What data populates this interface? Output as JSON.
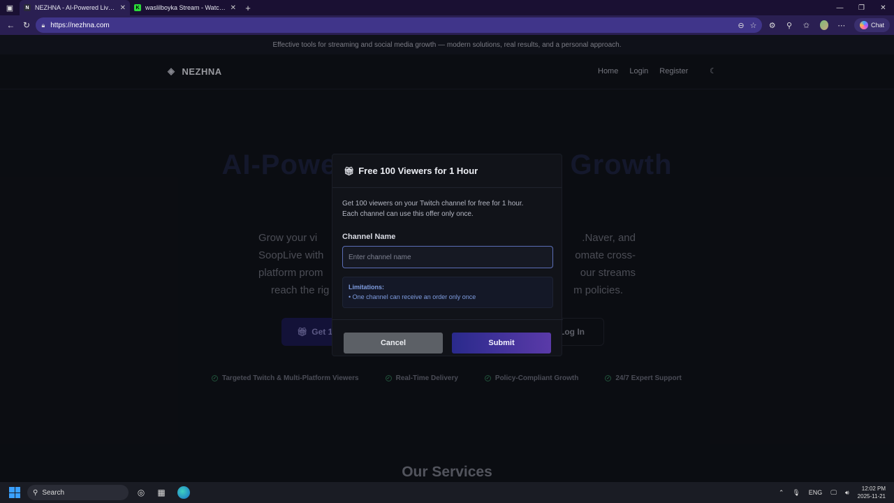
{
  "browser": {
    "tabs": [
      {
        "title": "NEZHNA - AI-Powered Live Strea",
        "favicon": "N",
        "active": true
      },
      {
        "title": "waslilboyka Stream - Watch Live o",
        "favicon": "K",
        "active": false
      }
    ],
    "url": "https://nezhna.com",
    "chat_label": "Chat"
  },
  "site": {
    "announcement": "Effective tools for streaming and social media growth — modern solutions, real results, and a personal approach.",
    "logo": "NEZHNA",
    "nav": {
      "home": "Home",
      "login": "Login",
      "register": "Register"
    },
    "hero": {
      "title_left": "AI-Powe",
      "title_right": "Growth",
      "text_lines": [
        {
          "left": "Grow your vi",
          "right": ".Naver, and"
        },
        {
          "left": "SoopLive with",
          "right": "omate cross-"
        },
        {
          "left": "platform prom",
          "right": "our streams"
        },
        {
          "left": "reach the rig",
          "right": "m policies."
        }
      ],
      "cta": "Get 1(",
      "login": "Log In"
    },
    "features": [
      "Targeted Twitch & Multi-Platform Viewers",
      "Real-Time Delivery",
      "Policy-Compliant Growth",
      "24/7 Expert Support"
    ],
    "services_title": "Our Services"
  },
  "modal": {
    "title": "Free 100 Viewers for 1 Hour",
    "description_1": "Get 100 viewers on your Twitch channel for free for 1 hour.",
    "description_2": "Each channel can use this offer only once.",
    "field_label": "Channel Name",
    "field_placeholder": "Enter channel name",
    "field_value": "",
    "limitations_title": "Limitations:",
    "limitations_item": "• One channel can receive an order only once",
    "cancel": "Cancel",
    "submit": "Submit"
  },
  "taskbar": {
    "search": "Search",
    "lang": "ENG",
    "time": "12:02 PM",
    "date": "2025-11-21"
  }
}
